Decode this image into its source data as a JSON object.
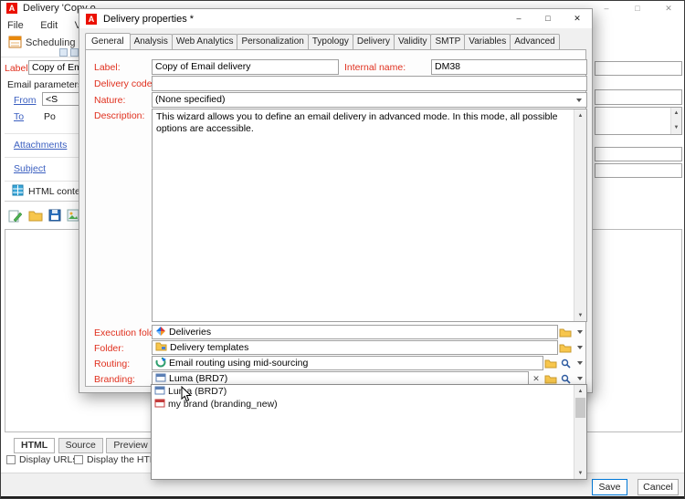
{
  "colors": {
    "brand_red": "#eb1000",
    "label_red": "#e0301e",
    "link_blue": "#3b5fc0",
    "accent_blue": "#0078d7",
    "folder_yellow": "#f7c64c"
  },
  "icons": {
    "minimize": "–",
    "maximize": "□",
    "close": "✕",
    "clear": "✕",
    "scroll_up": "▲",
    "scroll_down": "▼"
  },
  "app": {
    "logo_letter": "A",
    "title": "Delivery 'Copy o",
    "menu": [
      "File",
      "Edit",
      "View"
    ],
    "toolbar": {
      "scheduling": "Scheduling"
    },
    "form": {
      "label_caption": "Label:",
      "label_value": "Copy of Ema",
      "section_email": "Email parameters",
      "from_link": "From",
      "from_value": "<S",
      "to_link": "To",
      "to_value": "Po",
      "attachments_link": "Attachments",
      "subject_link": "Subject",
      "section_html": "HTML conte"
    },
    "bottom_tabs": [
      "HTML",
      "Source",
      "Preview"
    ],
    "checkboxes": [
      "Display URLs",
      "Display the HTML c"
    ],
    "save_button": "Save",
    "cancel_button": "Cancel"
  },
  "dialog": {
    "title": "Delivery properties *",
    "tabs": [
      "General",
      "Analysis",
      "Web Analytics",
      "Personalization",
      "Typology",
      "Delivery",
      "Validity",
      "SMTP",
      "Variables",
      "Advanced"
    ],
    "active_tab": "General",
    "fields": {
      "label_caption": "Label:",
      "label_value": "Copy of Email delivery",
      "internal_name_caption": "Internal name:",
      "internal_name_value": "DM38",
      "delivery_code_caption": "Delivery code:",
      "delivery_code_value": "",
      "nature_caption": "Nature:",
      "nature_value": "(None specified)",
      "description_caption": "Description:",
      "description_value": "This wizard allows you to define an email delivery in advanced mode. In this mode, all possible options are accessible."
    },
    "pickers": [
      {
        "caption": "Execution folder:",
        "value": "Deliveries"
      },
      {
        "caption": "Folder:",
        "value": "Delivery templates"
      },
      {
        "caption": "Routing:",
        "value": "Email routing using mid-sourcing"
      },
      {
        "caption": "Branding:",
        "value": "Luma (BRD7)"
      }
    ],
    "branding_dropdown": {
      "items": [
        {
          "label": "Luma (BRD7)"
        },
        {
          "label": "my brand (branding_new)"
        }
      ]
    }
  }
}
